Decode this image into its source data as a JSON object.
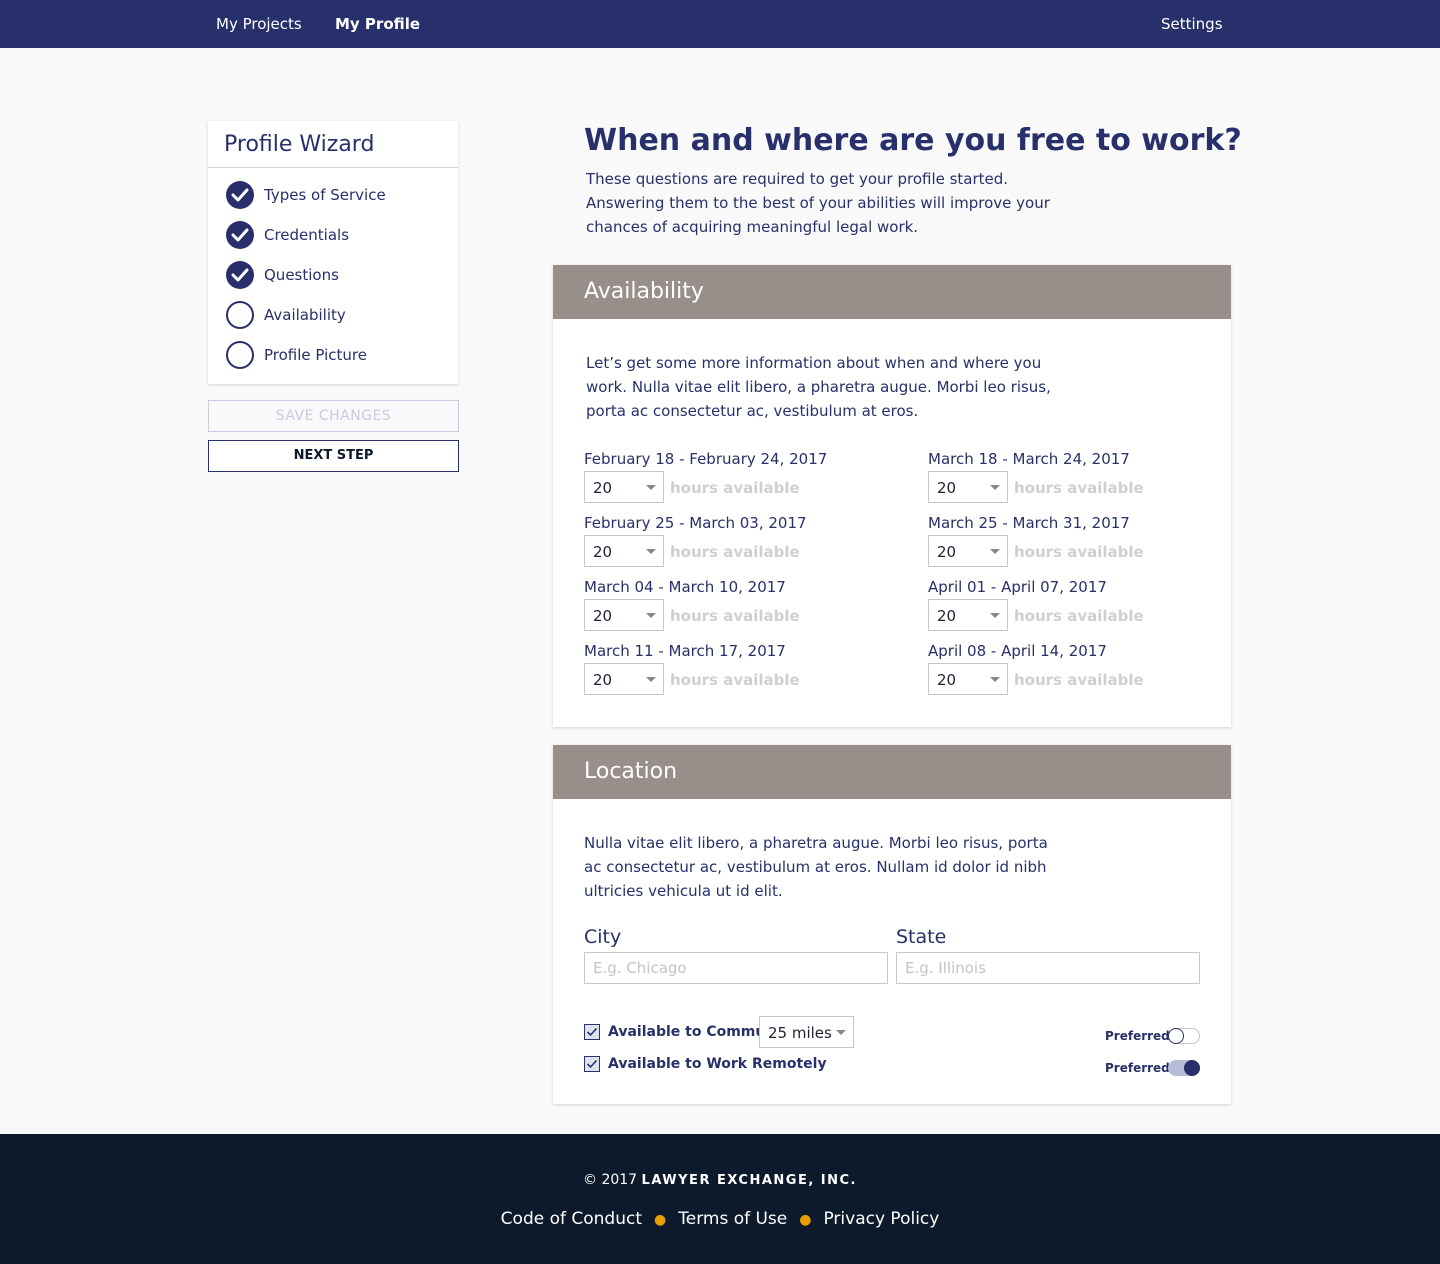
{
  "nav": {
    "my_projects": "My Projects",
    "my_profile": "My Profile",
    "settings": "Settings"
  },
  "wizard": {
    "title": "Profile Wizard",
    "steps": [
      {
        "label": "Types of Service",
        "complete": true
      },
      {
        "label": "Credentials",
        "complete": true
      },
      {
        "label": "Questions",
        "complete": true
      },
      {
        "label": "Availability",
        "complete": false
      },
      {
        "label": "Profile Picture",
        "complete": false
      }
    ],
    "save_label": "SAVE CHANGES",
    "next_label": "NEXT STEP"
  },
  "main": {
    "title": "When and where are you free to work?",
    "intro": "These questions are required to get your profile started. Answering them to the best of your abilities will improve your chances of acquiring meaningful legal work."
  },
  "availability": {
    "title": "Availability",
    "description": "Let’s get some more information about when and where you work. Nulla vitae elit libero, a pharetra augue. Morbi leo risus, porta ac consectetur ac, vestibulum at eros.",
    "hours_suffix": "hours available",
    "weeks": [
      {
        "label": "February 18 - February 24, 2017",
        "hours": "20"
      },
      {
        "label": "February 25 - March 03, 2017",
        "hours": "20"
      },
      {
        "label": "March 04 - March 10, 2017",
        "hours": "20"
      },
      {
        "label": "March 11 - March 17, 2017",
        "hours": "20"
      },
      {
        "label": "March 18 - March 24, 2017",
        "hours": "20"
      },
      {
        "label": "March 25 - March 31, 2017",
        "hours": "20"
      },
      {
        "label": "April 01 - April 07, 2017",
        "hours": "20"
      },
      {
        "label": "April 08 - April 14, 2017",
        "hours": "20"
      }
    ]
  },
  "location": {
    "title": "Location",
    "description": "Nulla vitae elit libero, a pharetra augue. Morbi leo risus, porta ac consectetur ac, vestibulum at eros. Nullam id dolor id nibh ultricies vehicula ut id elit.",
    "city_label": "City",
    "city_placeholder": "E.g. Chicago",
    "city_value": "",
    "state_label": "State",
    "state_placeholder": "E.g. Illinois",
    "state_value": "",
    "commute_label": "Available to Commute",
    "commute_checked": true,
    "commute_distance": "25 miles",
    "commute_preferred_label": "Preferred",
    "commute_preferred": false,
    "remote_label": "Available to Work Remotely",
    "remote_checked": true,
    "remote_preferred_label": "Preferred",
    "remote_preferred": true
  },
  "footer": {
    "copyright_prefix": "© 2017",
    "company": "LAWYER EXCHANGE, INC.",
    "links": [
      "Code of Conduct",
      "Terms of Use",
      "Privacy Policy"
    ]
  },
  "colors": {
    "navy": "#27306a",
    "section_header": "#998f8a",
    "footer_bg": "#0c1a2b",
    "footer_dot": "#e8a000"
  },
  "icons": {
    "step_complete": "checkmark-circle-icon",
    "step_incomplete": "empty-circle-icon",
    "select": "caret-down-icon",
    "checkbox": "checkmark-icon"
  }
}
